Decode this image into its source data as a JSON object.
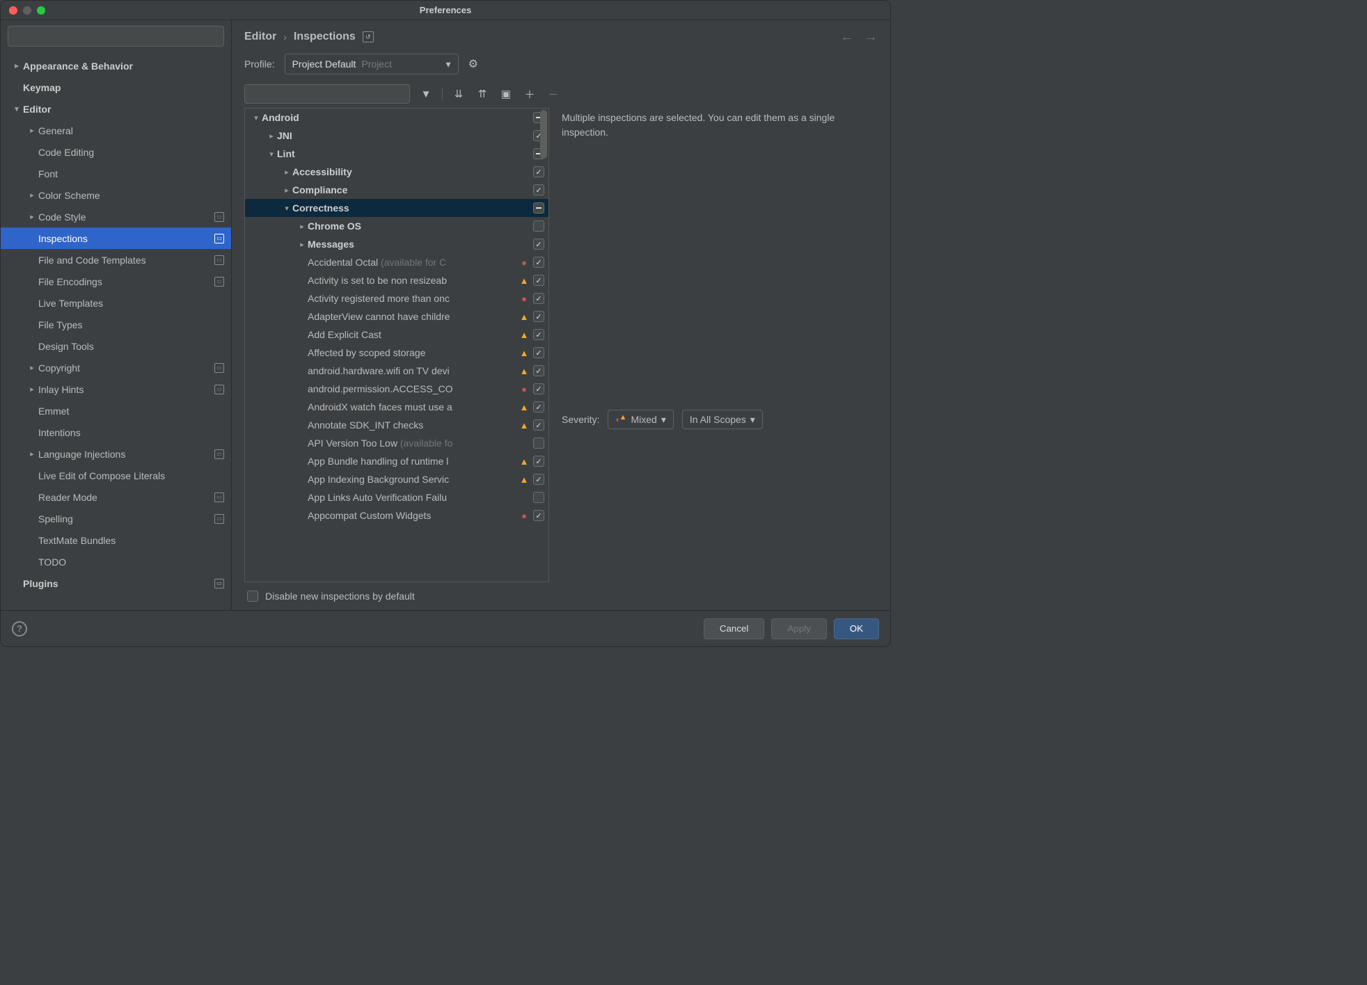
{
  "window": {
    "title": "Preferences"
  },
  "search": {
    "placeholder": ""
  },
  "sidebar": {
    "items": [
      {
        "label": "Appearance & Behavior",
        "bold": true,
        "indent": 0,
        "chev": "right"
      },
      {
        "label": "Keymap",
        "bold": true,
        "indent": 0
      },
      {
        "label": "Editor",
        "bold": true,
        "indent": 0,
        "chev": "down"
      },
      {
        "label": "General",
        "indent": 1,
        "chev": "right"
      },
      {
        "label": "Code Editing",
        "indent": 1
      },
      {
        "label": "Font",
        "indent": 1
      },
      {
        "label": "Color Scheme",
        "indent": 1,
        "chev": "right"
      },
      {
        "label": "Code Style",
        "indent": 1,
        "chev": "right",
        "badge": true
      },
      {
        "label": "Inspections",
        "indent": 1,
        "badge": true,
        "selected": true
      },
      {
        "label": "File and Code Templates",
        "indent": 1,
        "badge": true
      },
      {
        "label": "File Encodings",
        "indent": 1,
        "badge": true
      },
      {
        "label": "Live Templates",
        "indent": 1
      },
      {
        "label": "File Types",
        "indent": 1
      },
      {
        "label": "Design Tools",
        "indent": 1
      },
      {
        "label": "Copyright",
        "indent": 1,
        "chev": "right",
        "badge": true
      },
      {
        "label": "Inlay Hints",
        "indent": 1,
        "chev": "right",
        "badge": true
      },
      {
        "label": "Emmet",
        "indent": 1
      },
      {
        "label": "Intentions",
        "indent": 1
      },
      {
        "label": "Language Injections",
        "indent": 1,
        "chev": "right",
        "badge": true
      },
      {
        "label": "Live Edit of Compose Literals",
        "indent": 1
      },
      {
        "label": "Reader Mode",
        "indent": 1,
        "badge": true
      },
      {
        "label": "Spelling",
        "indent": 1,
        "badge": true
      },
      {
        "label": "TextMate Bundles",
        "indent": 1
      },
      {
        "label": "TODO",
        "indent": 1
      },
      {
        "label": "Plugins",
        "bold": true,
        "indent": 0,
        "badge": true
      }
    ]
  },
  "breadcrumb": {
    "a": "Editor",
    "b": "Inspections"
  },
  "profile": {
    "label": "Profile:",
    "selected": "Project Default",
    "tag": "Project"
  },
  "inspections": {
    "rows": [
      {
        "indent": 0,
        "chev": "down",
        "bold": true,
        "label": "Android",
        "cb": "partial"
      },
      {
        "indent": 1,
        "chev": "right",
        "bold": true,
        "label": "JNI",
        "cb": "checked"
      },
      {
        "indent": 1,
        "chev": "down",
        "bold": true,
        "label": "Lint",
        "cb": "partial"
      },
      {
        "indent": 2,
        "chev": "right",
        "bold": true,
        "label": "Accessibility",
        "cb": "checked"
      },
      {
        "indent": 2,
        "chev": "right",
        "bold": true,
        "label": "Compliance",
        "cb": "checked"
      },
      {
        "indent": 2,
        "chev": "down",
        "bold": true,
        "label": "Correctness",
        "cb": "partial",
        "selected": true
      },
      {
        "indent": 3,
        "chev": "right",
        "bold": true,
        "label": "Chrome OS",
        "cb": "unchecked"
      },
      {
        "indent": 3,
        "chev": "right",
        "bold": true,
        "label": "Messages",
        "cb": "checked"
      },
      {
        "indent": 3,
        "label": "Accidental Octal",
        "hint": "(available for C",
        "sev": "err",
        "cb": "checked"
      },
      {
        "indent": 3,
        "label": "Activity is set to be non resizeab",
        "sev": "warn",
        "cb": "checked"
      },
      {
        "indent": 3,
        "label": "Activity registered more than onc",
        "sev": "err",
        "cb": "checked"
      },
      {
        "indent": 3,
        "label": "AdapterView cannot have childre",
        "sev": "warn",
        "cb": "checked"
      },
      {
        "indent": 3,
        "label": "Add Explicit Cast",
        "sev": "warn",
        "cb": "checked"
      },
      {
        "indent": 3,
        "label": "Affected by scoped storage",
        "sev": "warn",
        "cb": "checked"
      },
      {
        "indent": 3,
        "label": "android.hardware.wifi on TV devi",
        "sev": "warn",
        "cb": "checked"
      },
      {
        "indent": 3,
        "label": "android.permission.ACCESS_CO",
        "sev": "err",
        "cb": "checked"
      },
      {
        "indent": 3,
        "label": "AndroidX watch faces must use a",
        "sev": "warn",
        "cb": "checked"
      },
      {
        "indent": 3,
        "label": "Annotate SDK_INT checks",
        "sev": "warn",
        "cb": "checked"
      },
      {
        "indent": 3,
        "label": "API Version Too Low",
        "hint": "(available fo",
        "cb": "unchecked"
      },
      {
        "indent": 3,
        "label": "App Bundle handling of runtime l",
        "sev": "warn",
        "cb": "checked"
      },
      {
        "indent": 3,
        "label": "App Indexing Background Servic",
        "sev": "warn",
        "cb": "checked"
      },
      {
        "indent": 3,
        "label": "App Links Auto Verification Failu",
        "cb": "unchecked"
      },
      {
        "indent": 3,
        "label": "Appcompat Custom Widgets",
        "sev": "err",
        "cb": "checked"
      }
    ]
  },
  "details": {
    "description": "Multiple inspections are selected. You can edit them as a single inspection.",
    "severity_label": "Severity:",
    "severity_value": "Mixed",
    "scope_value": "In All Scopes"
  },
  "bottom": {
    "disable_label": "Disable new inspections by default"
  },
  "footer": {
    "cancel": "Cancel",
    "apply": "Apply",
    "ok": "OK"
  }
}
